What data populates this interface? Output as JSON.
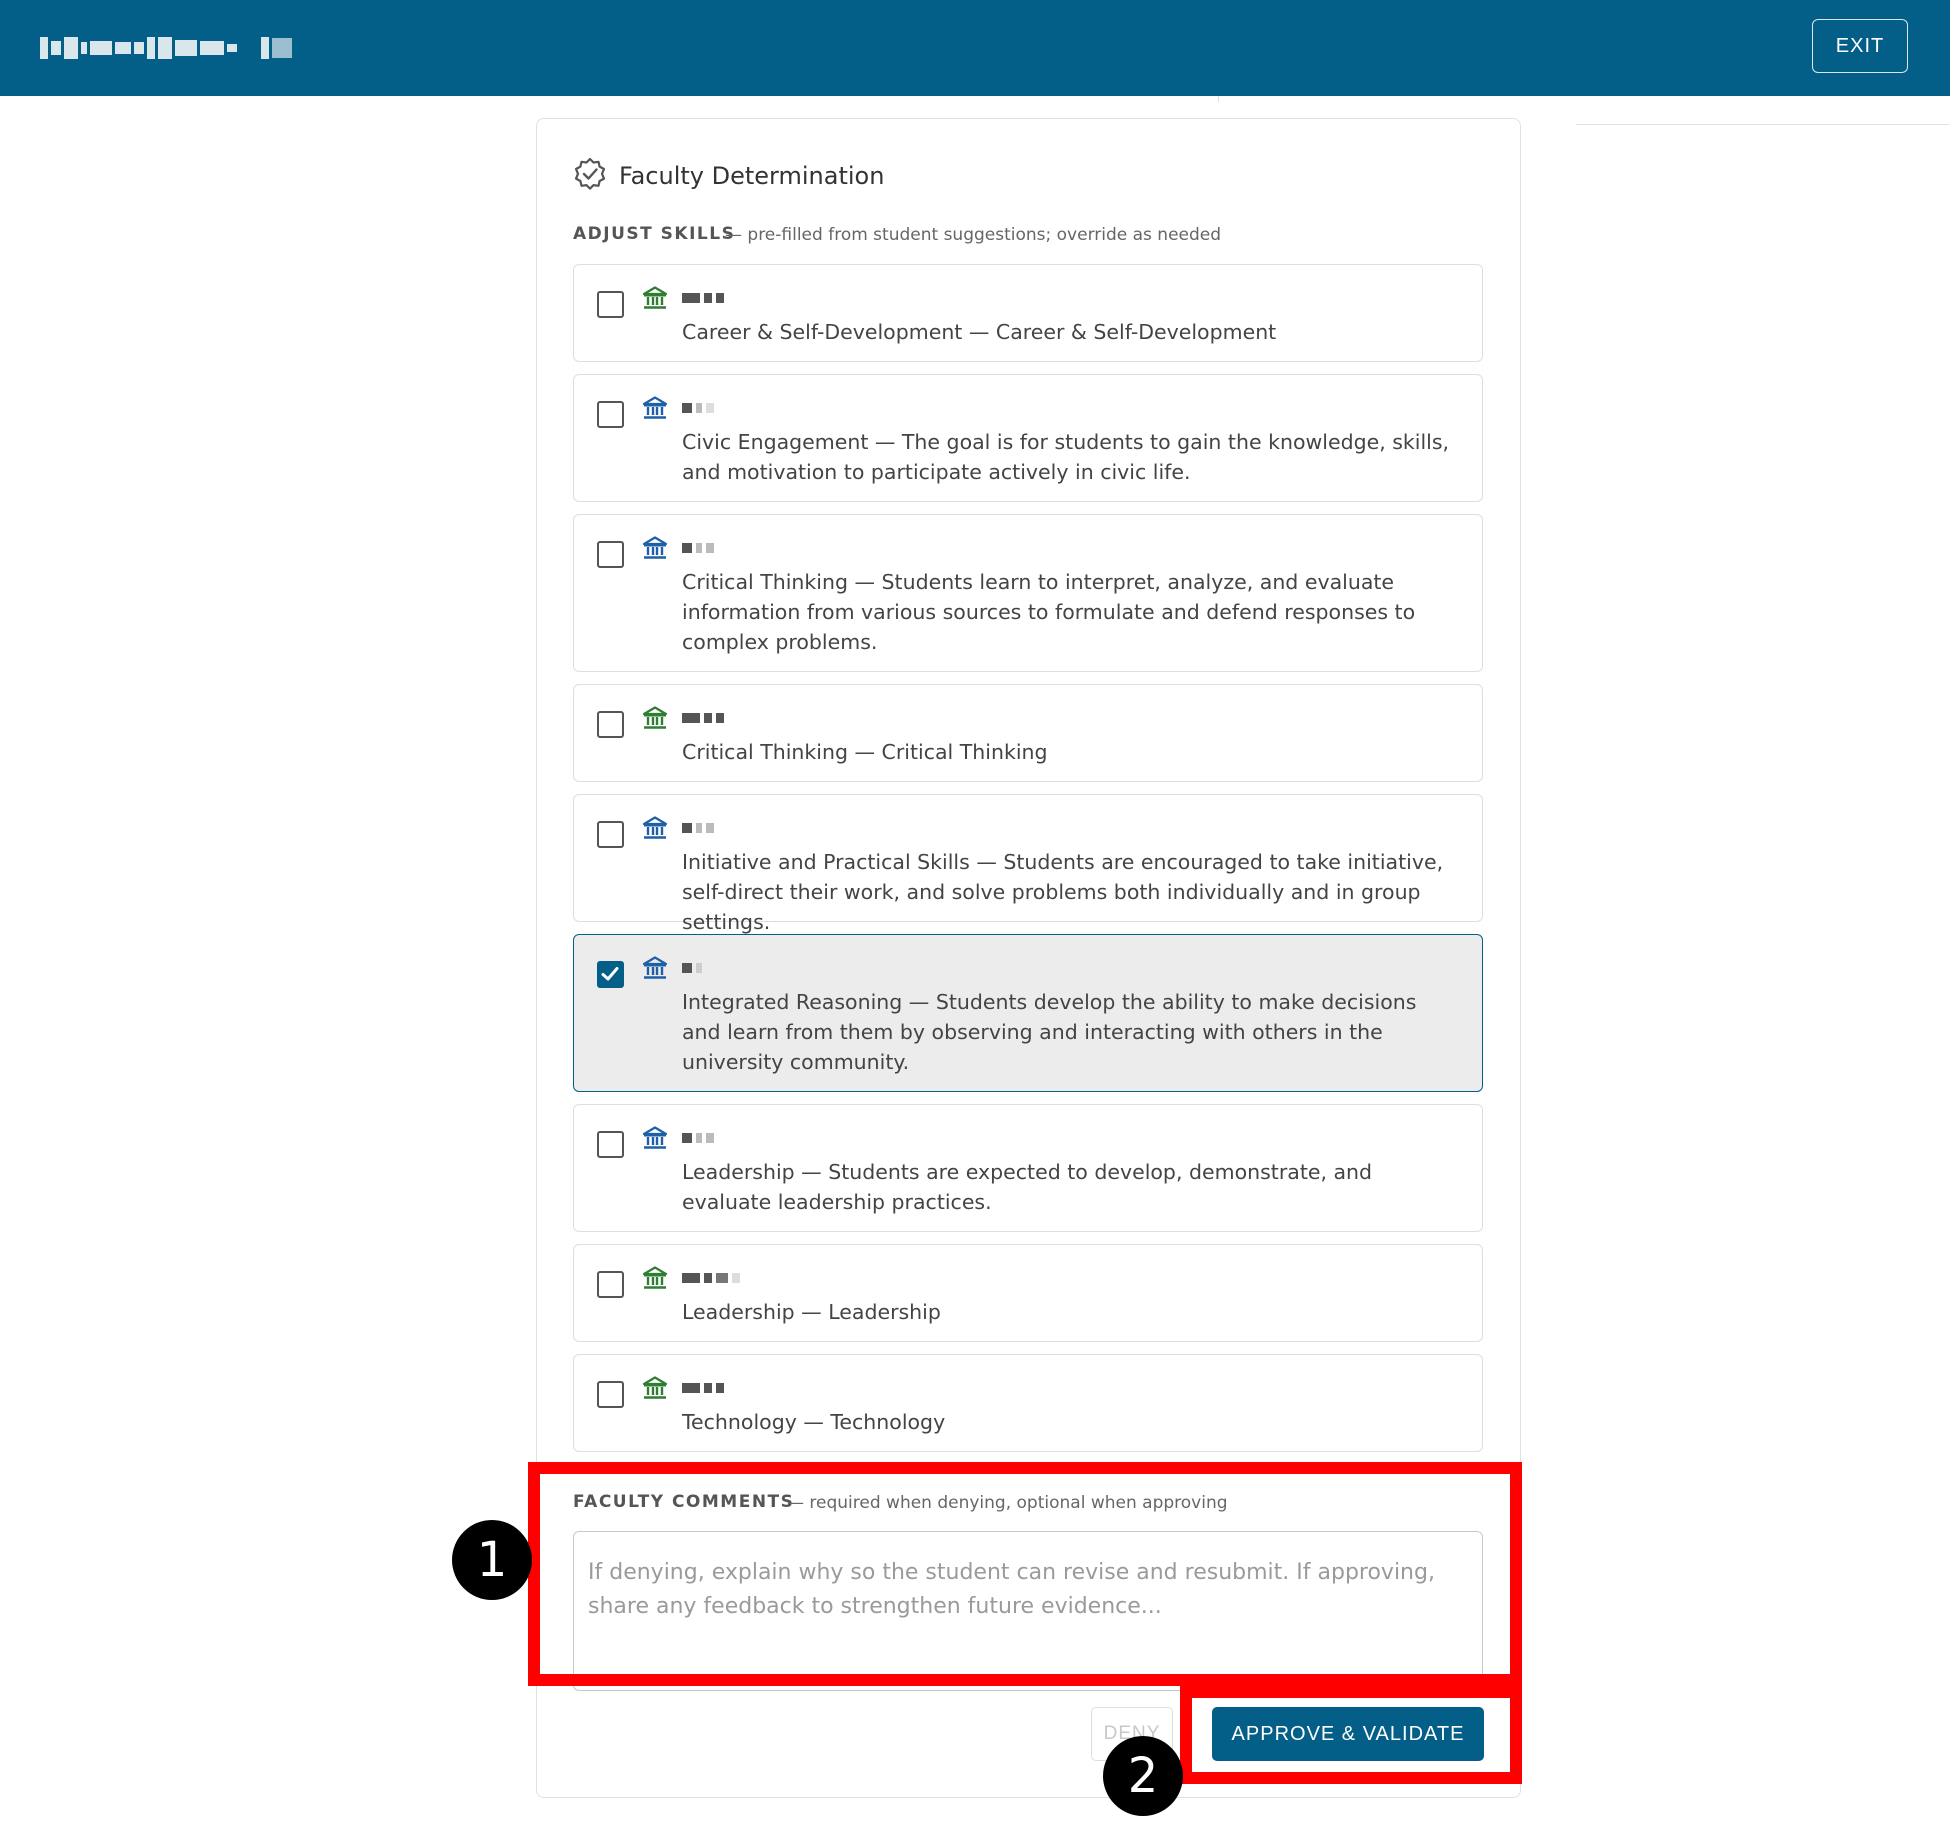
{
  "header": {
    "app_title": "",
    "exit_label": "EXIT"
  },
  "determination": {
    "title": "Faculty Determination",
    "adjust_label": "ADJUST SKILLS",
    "adjust_hint": "— pre-filled from student suggestions; override as needed",
    "skills": [
      {
        "text": "Career & Self-Development — Career & Self-Development",
        "checked": false,
        "icon_color": "#2e7d32"
      },
      {
        "text": "Civic Engagement — The goal is for students to gain the knowledge, skills, and motivation to participate actively in civic life.",
        "checked": false,
        "icon_color": "#1f5fa8"
      },
      {
        "text": "Critical Thinking — Students learn to interpret, analyze, and evaluate information from various sources to formulate and defend responses to complex problems.",
        "checked": false,
        "icon_color": "#1f5fa8"
      },
      {
        "text": "Critical Thinking — Critical Thinking",
        "checked": false,
        "icon_color": "#2e7d32"
      },
      {
        "text": "Initiative and Practical Skills — Students are encouraged to take initiative, self-direct their work, and solve problems both individually and in group settings.",
        "checked": false,
        "icon_color": "#1f5fa8"
      },
      {
        "text": "Integrated Reasoning — Students develop the ability to make decisions and learn from them by observing and interacting with others in the university community.",
        "checked": true,
        "icon_color": "#1f5fa8"
      },
      {
        "text": "Leadership — Students are expected to develop, demonstrate, and evaluate leadership practices.",
        "checked": false,
        "icon_color": "#1f5fa8"
      },
      {
        "text": "Leadership — Leadership",
        "checked": false,
        "icon_color": "#2e7d32"
      },
      {
        "text": "Technology — Technology",
        "checked": false,
        "icon_color": "#2e7d32"
      }
    ],
    "comments_label": "FACULTY COMMENTS",
    "comments_hint": "— required when denying, optional when approving",
    "comments_placeholder": "If denying, explain why so the student can revise and resubmit. If approving, share any feedback to strengthen future evidence...",
    "comments_value": "",
    "deny_label": "DENY",
    "approve_label": "APPROVE & VALIDATE"
  },
  "annotations": [
    {
      "number": "1"
    },
    {
      "number": "2"
    }
  ],
  "colors": {
    "primary": "#035f87",
    "highlight": "#ff0000",
    "institution_green": "#2e7d32",
    "institution_blue": "#1f5fa8"
  }
}
